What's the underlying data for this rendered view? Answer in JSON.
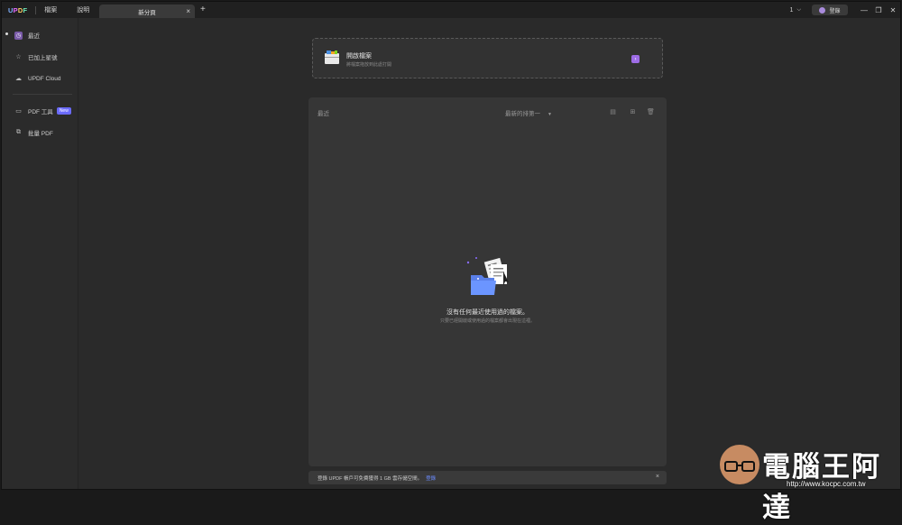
{
  "app": {
    "logo_text": "UPDF",
    "menu": [
      "檔案",
      "說明"
    ]
  },
  "tabs": [
    {
      "label": "新分頁",
      "close": "×"
    }
  ],
  "tab_add": "+",
  "titlebar": {
    "page_count": "1",
    "login_label": "登錄",
    "minimize": "—",
    "restore": "❐",
    "close": "✕"
  },
  "sidebar": {
    "items": [
      {
        "label": "最近",
        "icon": "clock-icon",
        "active": true
      },
      {
        "label": "已加上星號",
        "icon": "star-icon"
      },
      {
        "label": "UPDF Cloud",
        "icon": "cloud-icon"
      },
      {
        "label": "PDF 工具",
        "icon": "toolbox-icon",
        "badge": "New"
      },
      {
        "label": "批量 PDF",
        "icon": "stack-icon"
      }
    ]
  },
  "open_card": {
    "title": "開啟檔案",
    "subtitle": "將檔案拖放到此處打開"
  },
  "recent": {
    "label": "最近",
    "sort_label": "最新的排第一",
    "empty_title": "沒有任何最近使用過的檔案。",
    "empty_subtitle": "只要已經開啟或使用過的檔案都會出現在這裡。"
  },
  "banner": {
    "text": "登錄 UPDF 帳戶可免費獲得 1 GB 雲存儲空間。",
    "link": "登錄",
    "close": "×"
  },
  "watermark": {
    "title": "電腦王阿達",
    "url": "http://www.kocpc.com.tw"
  },
  "colors": {
    "accent": "#9d6ce6",
    "badge": "#6b6bff",
    "link": "#6c8cff"
  }
}
